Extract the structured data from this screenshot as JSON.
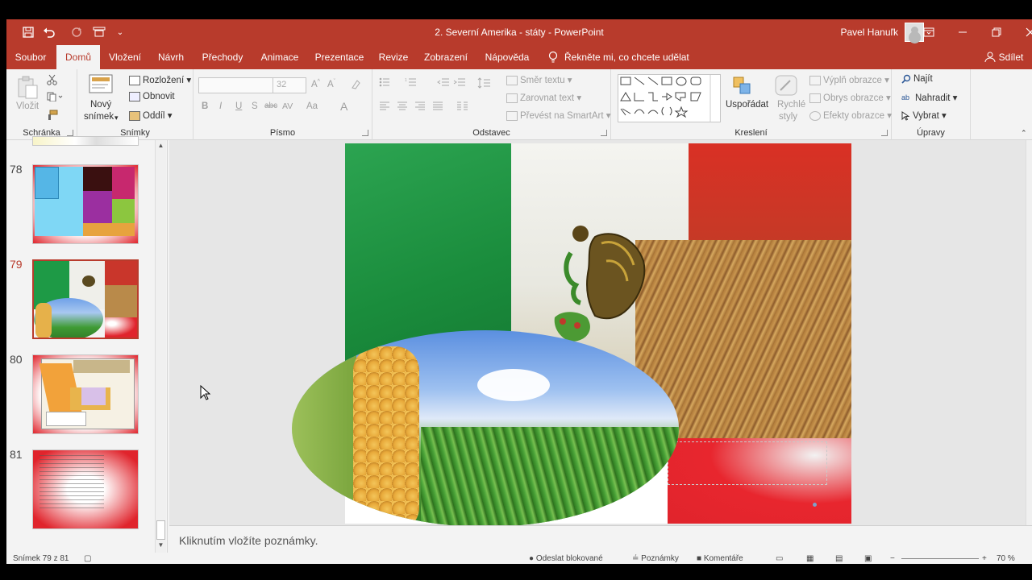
{
  "titlebar": {
    "title": "2. Severní Amerika - státy  -  PowerPoint",
    "user": "Pavel Hanuľk",
    "qat_icons": [
      "save-icon",
      "undo-icon",
      "redo-icon",
      "present-from-start-icon",
      "customize-qat-icon"
    ],
    "accent_color": "#b83b2c"
  },
  "tabs": [
    "Soubor",
    "Domů",
    "Vložení",
    "Návrh",
    "Přechody",
    "Animace",
    "Prezentace",
    "Revize",
    "Zobrazení",
    "Nápověda"
  ],
  "active_tab": "Domů",
  "tell_me": "Řekněte mi, co chcete udělat",
  "share": "Sdílet",
  "ribbon": {
    "clipboard": {
      "label": "Schránka",
      "paste": "Vložit"
    },
    "slides": {
      "label": "Snímky",
      "new_slide_1": "Nový",
      "new_slide_2": "snímek",
      "layout": "Rozložení",
      "reset": "Obnovit",
      "section": "Oddíl"
    },
    "font": {
      "label": "Písmo",
      "size": "32",
      "bold": "B",
      "italic": "I",
      "underline": "U",
      "shadow": "S",
      "strike": "abc",
      "spacing": "AV",
      "case": "Aa",
      "color": "A"
    },
    "paragraph": {
      "label": "Odstavec",
      "text_direction": "Směr textu",
      "align_text": "Zarovnat text",
      "smartart": "Převést na SmartArt"
    },
    "drawing": {
      "label": "Kreslení",
      "arrange": "Uspořádat",
      "quick_styles_1": "Rychlé",
      "quick_styles_2": "styly",
      "fill": "Výplň obrazce",
      "outline": "Obrys obrazce",
      "effects": "Efekty obrazce"
    },
    "editing": {
      "label": "Úpravy",
      "find": "Najít",
      "replace": "Nahradit",
      "select": "Vybrat"
    }
  },
  "slides_pane": {
    "items": [
      {
        "number": "78",
        "selected": false
      },
      {
        "number": "79",
        "selected": true
      },
      {
        "number": "80",
        "selected": false
      },
      {
        "number": "81",
        "selected": false
      }
    ]
  },
  "notes_placeholder": "Kliknutím vložíte poznámky.",
  "status": {
    "slide_counter": "Snímek 79 z 81",
    "send_blocked": "Odeslat blokované",
    "notes": "Poznámky",
    "comments": "Komentáře",
    "zoom": "70 %"
  }
}
